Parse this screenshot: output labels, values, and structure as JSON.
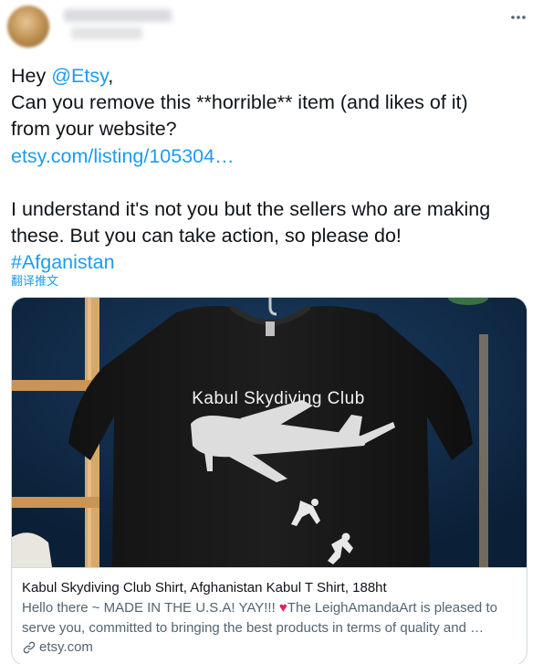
{
  "tweet": {
    "greeting": "Hey ",
    "mention": "@Etsy",
    "greeting_end": ",",
    "line2": "Can you remove this **horrible** item (and likes of it)",
    "line3": "from your website?",
    "link": "etsy.com/listing/105304…",
    "line5": "I understand it's not you but the sellers who are making",
    "line6": "these. But you can take action, so please do!",
    "hashtag": "#Afganistan",
    "translate_label": "翻译推文"
  },
  "card": {
    "image_shirt_text": "Kabul Skydiving Club",
    "title": "Kabul Skydiving Club Shirt, Afghanistan Kabul T Shirt, 188ht",
    "desc_line1_pre": "Hello there ~ MADE IN THE U.S.A! YAY!!! ",
    "desc_heart": "♥",
    "desc_line1_post": "The LeighAmandaArt is pleased to",
    "desc_line2": "serve you, committed to bringing the best products in terms of quality and …",
    "domain": "etsy.com"
  },
  "colors": {
    "link": "#1d9bf0",
    "text": "#0f1419",
    "secondary": "#536471",
    "heart": "#e0245e",
    "border": "#cfd9de"
  },
  "icons": {
    "more": "more-horizontal-icon",
    "link": "link-icon",
    "heart": "heart-emoji"
  }
}
